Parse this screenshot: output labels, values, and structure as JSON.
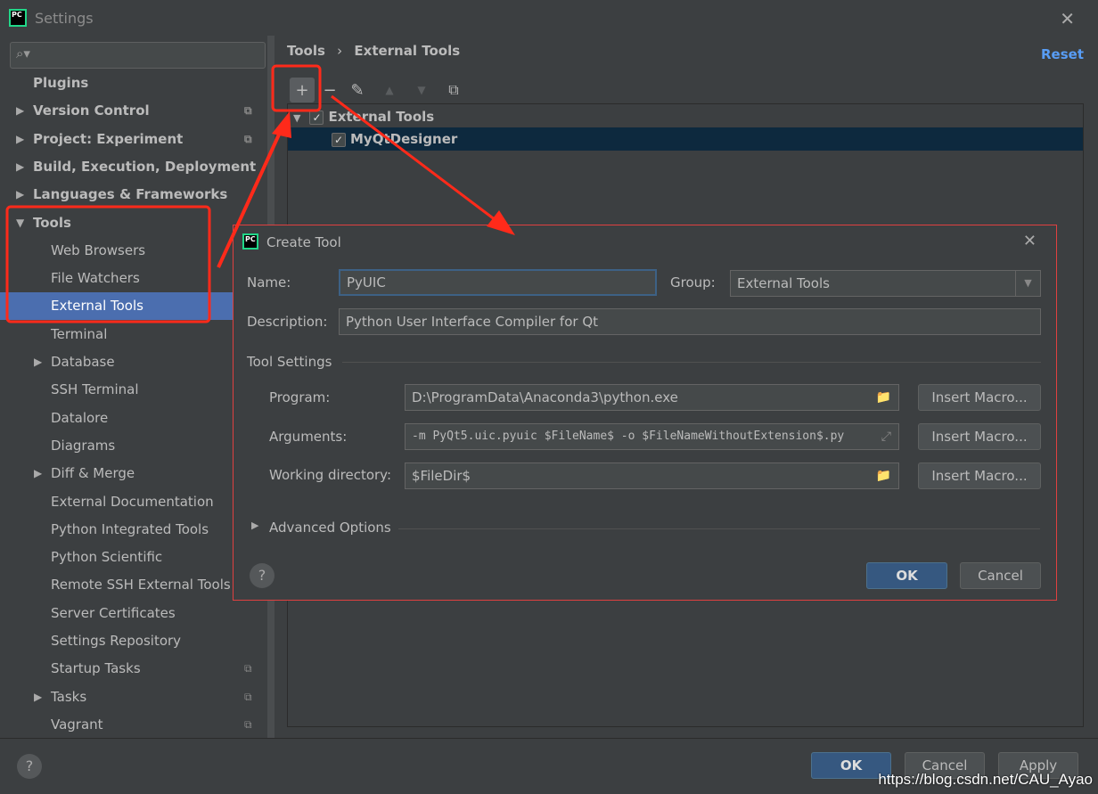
{
  "window": {
    "title": "Settings",
    "close_icon": "close-icon"
  },
  "sidebar": {
    "search_placeholder": "",
    "items": [
      {
        "label": "Plugins",
        "level": 0,
        "bold": true,
        "arrow": ""
      },
      {
        "label": "Version Control",
        "level": 0,
        "bold": true,
        "arrow": "right",
        "copy": true
      },
      {
        "label": "Project: Experiment",
        "level": 0,
        "bold": true,
        "arrow": "right",
        "copy": true
      },
      {
        "label": "Build, Execution, Deployment",
        "level": 0,
        "bold": true,
        "arrow": "right"
      },
      {
        "label": "Languages & Frameworks",
        "level": 0,
        "bold": true,
        "arrow": "right"
      },
      {
        "label": "Tools",
        "level": 0,
        "bold": true,
        "arrow": "down"
      },
      {
        "label": "Web Browsers",
        "level": 1
      },
      {
        "label": "File Watchers",
        "level": 1
      },
      {
        "label": "External Tools",
        "level": 1,
        "selected": true
      },
      {
        "label": "Terminal",
        "level": 1
      },
      {
        "label": "Database",
        "level": 1,
        "arrow": "right"
      },
      {
        "label": "SSH Terminal",
        "level": 1
      },
      {
        "label": "Datalore",
        "level": 1
      },
      {
        "label": "Diagrams",
        "level": 1
      },
      {
        "label": "Diff & Merge",
        "level": 1,
        "arrow": "right"
      },
      {
        "label": "External Documentation",
        "level": 1
      },
      {
        "label": "Python Integrated Tools",
        "level": 1
      },
      {
        "label": "Python Scientific",
        "level": 1
      },
      {
        "label": "Remote SSH External Tools",
        "level": 1
      },
      {
        "label": "Server Certificates",
        "level": 1
      },
      {
        "label": "Settings Repository",
        "level": 1
      },
      {
        "label": "Startup Tasks",
        "level": 1,
        "copy": true
      },
      {
        "label": "Tasks",
        "level": 1,
        "arrow": "right",
        "copy": true
      },
      {
        "label": "Vagrant",
        "level": 1,
        "copy": true
      }
    ]
  },
  "breadcrumb": {
    "parent": "Tools",
    "separator": "›",
    "current": "External Tools"
  },
  "reset_label": "Reset",
  "toolbar": [
    "add-icon",
    "remove-icon",
    "edit-icon",
    "move-up-icon",
    "move-down-icon",
    "copy-icon"
  ],
  "tree": {
    "group": {
      "label": "External Tools",
      "checked": true
    },
    "items": [
      {
        "label": "MyQtDesigner",
        "checked": true,
        "selected": true
      }
    ]
  },
  "footer": {
    "help": "?",
    "ok": "OK",
    "cancel": "Cancel",
    "apply": "Apply"
  },
  "dialog": {
    "title": "Create Tool",
    "name_label": "Name:",
    "name_value": "PyUIC",
    "group_label": "Group:",
    "group_value": "External Tools",
    "description_label": "Description:",
    "description_value": "Python User Interface Compiler for Qt",
    "section": "Tool Settings",
    "program_label": "Program:",
    "program_value": "D:\\ProgramData\\Anaconda3\\python.exe",
    "arguments_label": "Arguments:",
    "arguments_value": "-m PyQt5.uic.pyuic $FileName$ -o $FileNameWithoutExtension$.py",
    "workdir_label": "Working directory:",
    "workdir_value": "$FileDir$",
    "insert_macro": "Insert Macro...",
    "advanced": "Advanced Options",
    "help": "?",
    "ok": "OK",
    "cancel": "Cancel"
  },
  "watermark": "https://blog.csdn.net/CAU_Ayao",
  "colors": {
    "accent": "#4b6eaf",
    "annotation": "#ff2a1a",
    "primary_button": "#365880",
    "link": "#589df6"
  }
}
